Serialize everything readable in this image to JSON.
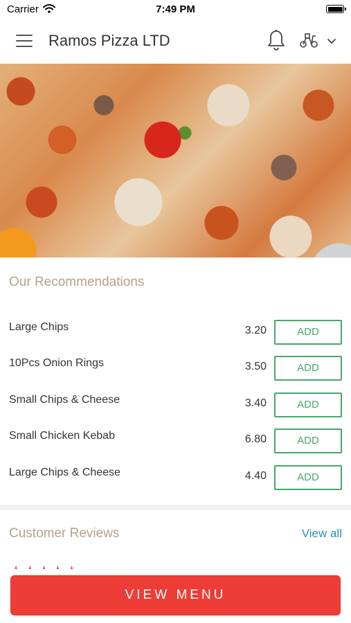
{
  "status_bar": {
    "carrier": "Carrier",
    "time": "7:49 PM"
  },
  "header": {
    "title": "Ramos Pizza LTD"
  },
  "recommendations": {
    "title": "Our Recommendations",
    "items": [
      {
        "name": "Large Chips",
        "price": "3.20",
        "action": "ADD"
      },
      {
        "name": "10Pcs Onion Rings",
        "price": "3.50",
        "action": "ADD"
      },
      {
        "name": "Small Chips & Cheese",
        "price": "3.40",
        "action": "ADD"
      },
      {
        "name": "Small Chicken Kebab",
        "price": "6.80",
        "action": "ADD"
      },
      {
        "name": "Large Chips & Cheese",
        "price": "4.40",
        "action": "ADD"
      }
    ]
  },
  "reviews": {
    "title": "Customer Reviews",
    "view_all": "View all",
    "stars": "★★★★★"
  },
  "footer": {
    "view_menu_label": "VIEW MENU"
  },
  "colors": {
    "accent": "#ec3d37",
    "add_green": "#45a86a",
    "link_blue": "#2f8fb4",
    "section_title": "#b4a289"
  }
}
